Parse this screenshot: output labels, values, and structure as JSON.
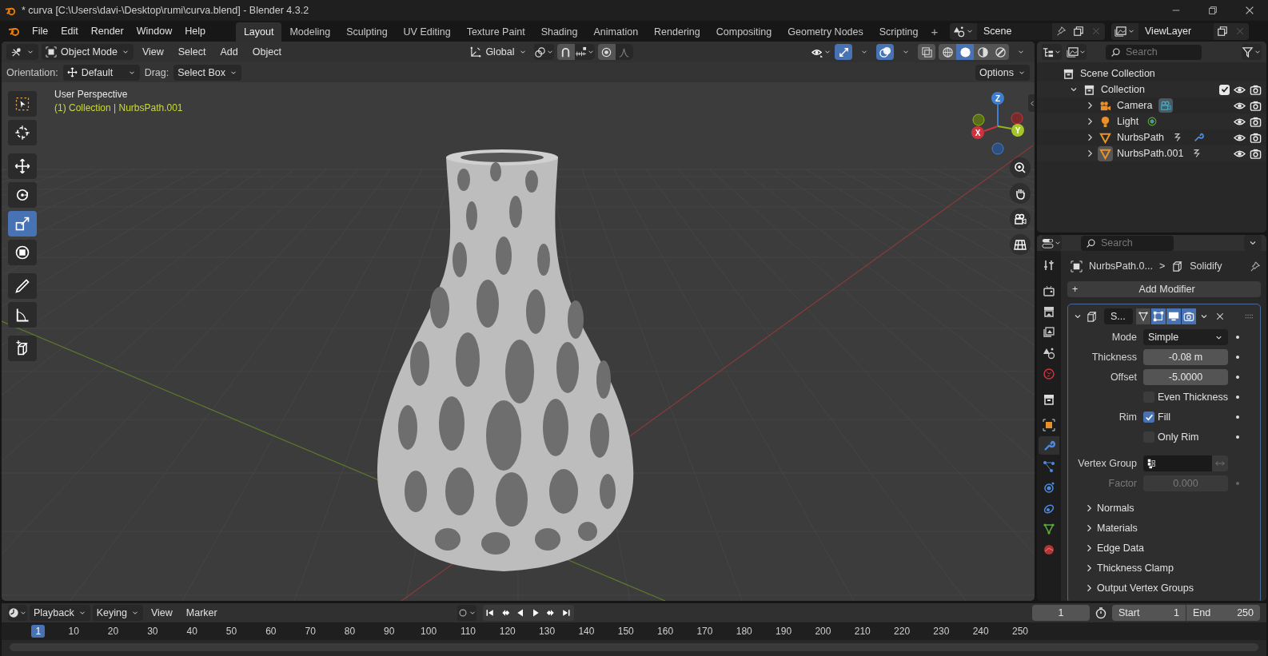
{
  "title_bar": {
    "title": "* curva [C:\\Users\\davi-\\Desktop\\rumi\\curva.blend] - Blender 4.3.2"
  },
  "menu": [
    "File",
    "Edit",
    "Render",
    "Window",
    "Help"
  ],
  "workspaces": [
    {
      "label": "Layout",
      "selected": true
    },
    {
      "label": "Modeling",
      "selected": false
    },
    {
      "label": "Sculpting",
      "selected": false
    },
    {
      "label": "UV Editing",
      "selected": false
    },
    {
      "label": "Texture Paint",
      "selected": false
    },
    {
      "label": "Shading",
      "selected": false
    },
    {
      "label": "Animation",
      "selected": false
    },
    {
      "label": "Rendering",
      "selected": false
    },
    {
      "label": "Compositing",
      "selected": false
    },
    {
      "label": "Geometry Nodes",
      "selected": false
    },
    {
      "label": "Scripting",
      "selected": false
    }
  ],
  "add_workspace": "+",
  "scene": {
    "name": "Scene"
  },
  "view_layer": {
    "name": "ViewLayer"
  },
  "viewport": {
    "mode": "Object Mode",
    "menus": [
      "View",
      "Select",
      "Add",
      "Object"
    ],
    "transform_orientation": "Global",
    "shading": [
      {
        "kind": "wireframe",
        "selected": false
      },
      {
        "kind": "solid",
        "selected": true
      },
      {
        "kind": "material",
        "selected": false
      },
      {
        "kind": "rendered",
        "selected": false
      }
    ],
    "tool_settings": {
      "orientation_label": "Orientation:",
      "orientation": "Default",
      "drag_label": "Drag:",
      "drag": "Select Box",
      "options": "Options"
    },
    "perspective": "User Perspective",
    "context": "(1) Collection | NurbsPath.001",
    "tools": [
      {
        "kind": "select",
        "selected": false
      },
      {
        "kind": "cursor",
        "selected": false
      },
      {
        "kind": "move",
        "selected": false
      },
      {
        "kind": "rotate",
        "selected": false
      },
      {
        "kind": "scale",
        "selected": true
      },
      {
        "kind": "transform",
        "selected": false
      },
      {
        "kind": "annotate",
        "selected": false
      },
      {
        "kind": "measure",
        "selected": false
      },
      {
        "kind": "add_cube",
        "selected": false
      }
    ],
    "gizmo": {
      "x": "X",
      "y": "Y",
      "z": "Z"
    }
  },
  "outliner": {
    "search": {
      "placeholder": "Search"
    },
    "tree": [
      {
        "kind": "scene_collection",
        "label": "Scene Collection",
        "children": [
          {
            "kind": "collection",
            "label": "Collection",
            "expanded": true,
            "checked": true,
            "children": [
              {
                "kind": "camera",
                "label": "Camera",
                "expanded": false,
                "active": false,
                "extras": [
                  {
                    "kind": "camera_data",
                    "highlighted": true
                  }
                ]
              },
              {
                "kind": "light",
                "label": "Light",
                "expanded": false,
                "active": false,
                "extras": [
                  {
                    "kind": "light_data",
                    "highlighted": false
                  }
                ]
              },
              {
                "kind": "curve",
                "label": "NurbsPath",
                "expanded": false,
                "active": false,
                "extras": [
                  {
                    "kind": "curve_data",
                    "highlighted": false
                  },
                  {
                    "kind": "modifier",
                    "highlighted": false
                  }
                ]
              },
              {
                "kind": "curve",
                "label": "NurbsPath.001",
                "expanded": false,
                "active": true,
                "extras": [
                  {
                    "kind": "curve_data",
                    "highlighted": false
                  }
                ]
              }
            ]
          }
        ]
      }
    ]
  },
  "properties": {
    "search": {
      "placeholder": "Search"
    },
    "tabs": [
      {
        "kind": "tool",
        "selected": false
      },
      {
        "kind": "render",
        "selected": false
      },
      {
        "kind": "output",
        "selected": false
      },
      {
        "kind": "view_layer",
        "selected": false
      },
      {
        "kind": "scene",
        "selected": false
      },
      {
        "kind": "world",
        "selected": false
      },
      {
        "kind": "collection",
        "selected": false
      },
      {
        "kind": "object",
        "selected": false
      },
      {
        "kind": "modifiers",
        "selected": true
      },
      {
        "kind": "particles",
        "selected": false
      },
      {
        "kind": "physics",
        "selected": false
      },
      {
        "kind": "constraints",
        "selected": false
      },
      {
        "kind": "data",
        "selected": false
      },
      {
        "kind": "material",
        "selected": false
      }
    ],
    "breadcrumb": {
      "object": "NurbsPath.0...",
      "separator": ">",
      "modifier": "Solidify"
    },
    "add_modifier": {
      "icon": "+",
      "label": "Add Modifier"
    },
    "modifier": {
      "name": "S...",
      "expanded": true,
      "toggles": [
        {
          "kind": "on_cage",
          "on": false
        },
        {
          "kind": "edit_mode",
          "on": true
        },
        {
          "kind": "viewport",
          "on": true
        },
        {
          "kind": "render",
          "on": true
        }
      ],
      "rows": [
        {
          "kind": "dropdown",
          "label": "Mode",
          "value": "Simple"
        },
        {
          "kind": "number",
          "label": "Thickness",
          "value": "-0.08 m"
        },
        {
          "kind": "number",
          "label": "Offset",
          "value": "-5.0000"
        },
        {
          "kind": "checkbox",
          "text": "Even Thickness",
          "checked": false
        },
        {
          "kind": "checkbox",
          "label": "Rim",
          "text": "Fill",
          "checked": true
        },
        {
          "kind": "checkbox",
          "text": "Only Rim",
          "checked": false
        },
        {
          "kind": "vertex_group",
          "label": "Vertex Group"
        },
        {
          "kind": "number",
          "label": "Factor",
          "value": "0.000",
          "disabled": true
        }
      ],
      "subpanels": [
        {
          "label": "Normals",
          "expanded": false
        },
        {
          "label": "Materials",
          "expanded": false
        },
        {
          "label": "Edge Data",
          "expanded": false
        },
        {
          "label": "Thickness Clamp",
          "expanded": false
        },
        {
          "label": "Output Vertex Groups",
          "expanded": false
        }
      ]
    }
  },
  "timeline": {
    "menus": [
      "Playback",
      "Keying",
      "View",
      "Marker"
    ],
    "current_frame": "1",
    "start_label": "Start",
    "start": "1",
    "end_label": "End",
    "end": "250",
    "ruler": [
      {
        "label": "1",
        "selected": true
      },
      {
        "label": "10",
        "selected": false
      },
      {
        "label": "20",
        "selected": false
      },
      {
        "label": "30",
        "selected": false
      },
      {
        "label": "40",
        "selected": false
      },
      {
        "label": "50",
        "selected": false
      },
      {
        "label": "60",
        "selected": false
      },
      {
        "label": "70",
        "selected": false
      },
      {
        "label": "80",
        "selected": false
      },
      {
        "label": "90",
        "selected": false
      },
      {
        "label": "100",
        "selected": false
      },
      {
        "label": "110",
        "selected": false
      },
      {
        "label": "120",
        "selected": false
      },
      {
        "label": "130",
        "selected": false
      },
      {
        "label": "140",
        "selected": false
      },
      {
        "label": "150",
        "selected": false
      },
      {
        "label": "160",
        "selected": false
      },
      {
        "label": "170",
        "selected": false
      },
      {
        "label": "180",
        "selected": false
      },
      {
        "label": "190",
        "selected": false
      },
      {
        "label": "200",
        "selected": false
      },
      {
        "label": "210",
        "selected": false
      },
      {
        "label": "220",
        "selected": false
      },
      {
        "label": "230",
        "selected": false
      },
      {
        "label": "240",
        "selected": false
      },
      {
        "label": "250",
        "selected": false
      }
    ]
  }
}
